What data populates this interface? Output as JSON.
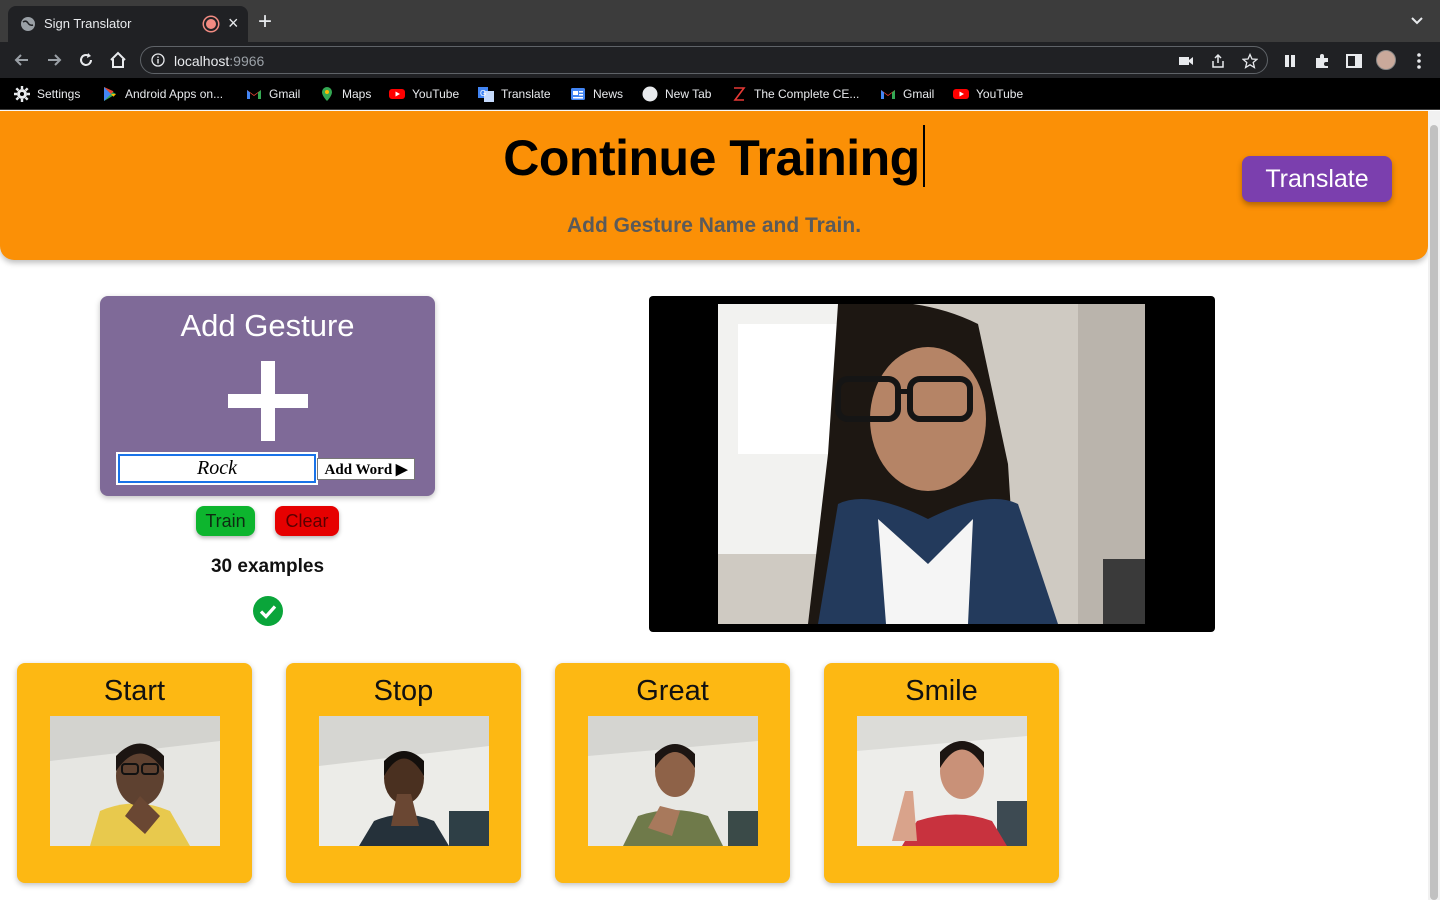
{
  "browser": {
    "tab_title": "Sign Translator",
    "url_host": "localhost",
    "url_port": ":9966",
    "bookmarks": [
      {
        "label": "Settings",
        "icon": "gear-icon"
      },
      {
        "label": "Android Apps on...",
        "icon": "play-store-icon"
      },
      {
        "label": "Gmail",
        "icon": "gmail-icon"
      },
      {
        "label": "Maps",
        "icon": "maps-icon"
      },
      {
        "label": "YouTube",
        "icon": "youtube-icon"
      },
      {
        "label": "Translate",
        "icon": "translate-icon"
      },
      {
        "label": "News",
        "icon": "news-icon"
      },
      {
        "label": "New Tab",
        "icon": "globe-icon"
      },
      {
        "label": "The Complete CE...",
        "icon": "zeta-icon"
      },
      {
        "label": "Gmail",
        "icon": "gmail-icon"
      },
      {
        "label": "YouTube",
        "icon": "youtube-icon"
      }
    ]
  },
  "header": {
    "title": "Continue Training",
    "subtitle": "Add Gesture Name and Train.",
    "translate_label": "Translate"
  },
  "add_gesture": {
    "title": "Add Gesture",
    "input_value": "Rock",
    "add_word_label": "Add Word ▶",
    "train_label": "Train",
    "clear_label": "Clear",
    "examples_text": "30 examples"
  },
  "gestures": [
    {
      "name": "Start"
    },
    {
      "name": "Stop"
    },
    {
      "name": "Great"
    },
    {
      "name": "Smile"
    }
  ],
  "colors": {
    "header_bg": "#fb9006",
    "add_card_bg": "#7f6a98",
    "translate_btn": "#7b3fae",
    "train_btn": "#0db52e",
    "clear_btn": "#e60000",
    "gesture_card_bg": "#fdb813"
  }
}
